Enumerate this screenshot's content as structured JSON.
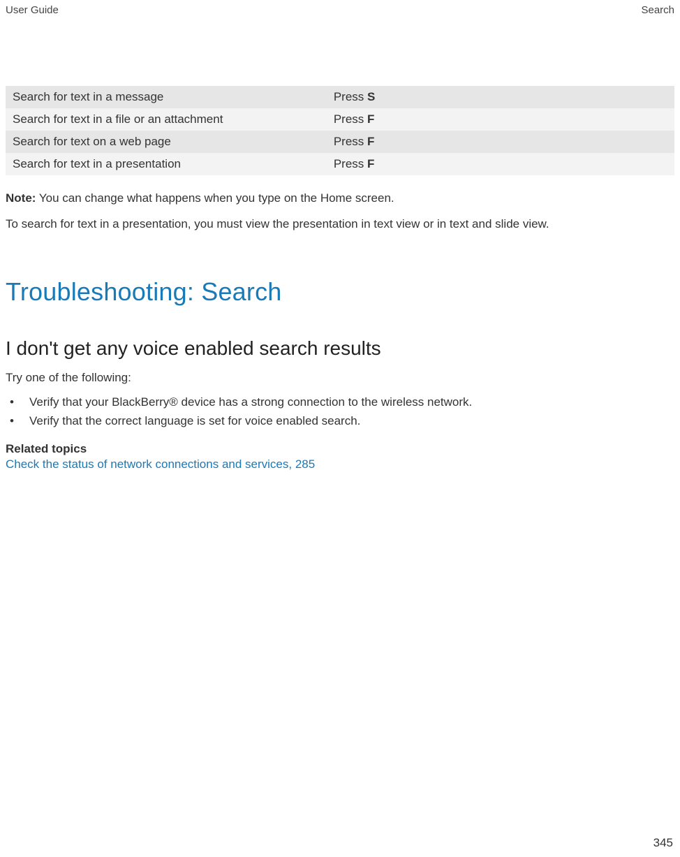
{
  "header": {
    "left": "User Guide",
    "right": "Search"
  },
  "table": {
    "rows": [
      {
        "action": "Search for text in a message",
        "press": "Press ",
        "key": "S"
      },
      {
        "action": "Search for text in a file or an attachment",
        "press": "Press ",
        "key": "F"
      },
      {
        "action": "Search for text on a web page",
        "press": "Press ",
        "key": "F"
      },
      {
        "action": "Search for text in a presentation",
        "press": "Press ",
        "key": "F"
      }
    ]
  },
  "note": {
    "label": "Note:",
    "text": " You can change what happens when you type on the Home screen."
  },
  "para2": "To search for text in a presentation, you must view the presentation in text view or in text and slide view.",
  "section_heading": "Troubleshooting: Search",
  "subsection_heading": "I don't get any voice enabled search results",
  "try_text": "Try one of the following:",
  "bullets": [
    "Verify that your BlackBerry® device has a strong connection to the wireless network.",
    "Verify that the correct language is set for voice enabled search."
  ],
  "related": {
    "label": "Related topics",
    "link": "Check the status of network connections and services, 285"
  },
  "page_number": "345"
}
